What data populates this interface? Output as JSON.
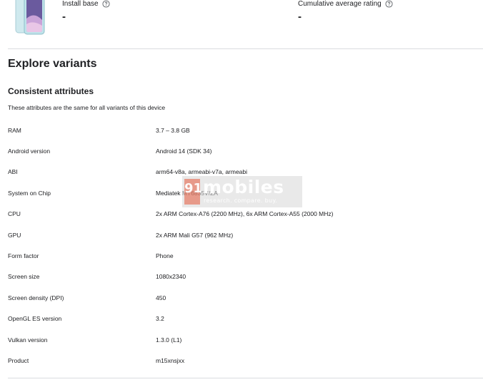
{
  "summary": {
    "install_base": {
      "label": "Install base",
      "value": "-"
    },
    "cumulative_rating": {
      "label": "Cumulative average rating",
      "value": "-"
    }
  },
  "section_title": "Explore variants",
  "consistent_attributes": {
    "title": "Consistent attributes",
    "description": "These attributes are the same for all variants of this device",
    "rows": [
      {
        "name": "RAM",
        "value": "3.7 – 3.8 GB"
      },
      {
        "name": "Android version",
        "value": "Android 14 (SDK 34)"
      },
      {
        "name": "ABI",
        "value": "arm64-v8a, armeabi-v7a, armeabi"
      },
      {
        "name": "System on Chip",
        "value": "Mediatek MT6835V/ZA"
      },
      {
        "name": "CPU",
        "value": "2x ARM Cortex-A76 (2200 MHz), 6x ARM Cortex-A55 (2000 MHz)"
      },
      {
        "name": "GPU",
        "value": "2x ARM Mali G57 (962 MHz)"
      },
      {
        "name": "Form factor",
        "value": "Phone"
      },
      {
        "name": "Screen size",
        "value": "1080x2340"
      },
      {
        "name": "Screen density (DPI)",
        "value": "450"
      },
      {
        "name": "OpenGL ES version",
        "value": "3.2"
      },
      {
        "name": "Vulkan version",
        "value": "1.3.0 (L1)"
      },
      {
        "name": "Product",
        "value": "m15xnsjxx"
      }
    ]
  },
  "watermark": {
    "mark": "91",
    "name": "mobiles",
    "tagline": "research. compare. buy."
  },
  "icons": {
    "help": "help-circle-icon",
    "device": "phone-image"
  },
  "colors": {
    "text": "#202124",
    "divider": "#dadce0",
    "phone_body": "#bfe3ea",
    "phone_screen": "#6a5a9e"
  }
}
